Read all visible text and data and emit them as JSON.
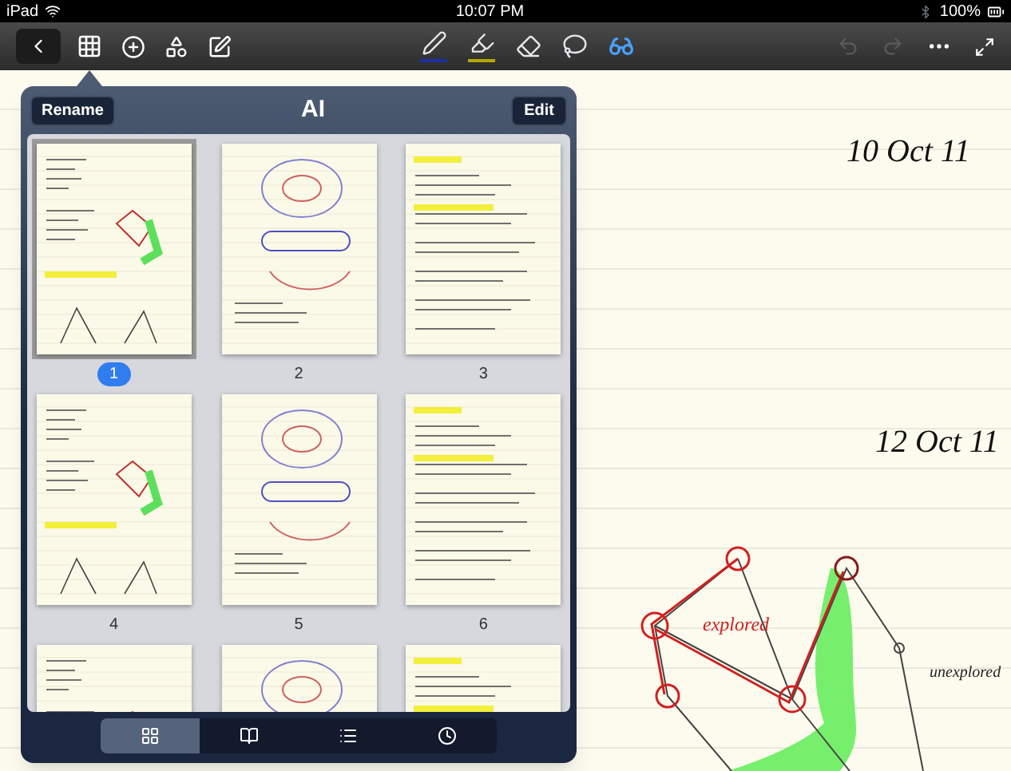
{
  "status_bar": {
    "device": "iPad",
    "time": "10:07 PM",
    "battery": "100%"
  },
  "toolbar": {
    "tools": [
      {
        "kind": "pen",
        "color": "#1f2fa8",
        "selected": false
      },
      {
        "kind": "highlighter",
        "color": "#b5a800",
        "selected": false
      },
      {
        "kind": "eraser",
        "selected": false
      },
      {
        "kind": "lasso",
        "selected": false
      },
      {
        "kind": "reader",
        "selected": true
      }
    ],
    "history": [
      {
        "kind": "undo",
        "disabled": true
      },
      {
        "kind": "redo",
        "disabled": true
      }
    ]
  },
  "popover": {
    "left_button": "Rename",
    "title": "AI",
    "right_button": "Edit",
    "pages": [
      {
        "number": "1",
        "selected": true
      },
      {
        "number": "2",
        "selected": false
      },
      {
        "number": "3",
        "selected": false
      },
      {
        "number": "4",
        "selected": false
      },
      {
        "number": "5",
        "selected": false
      },
      {
        "number": "6",
        "selected": false
      },
      {
        "selected": false
      },
      {
        "selected": false
      },
      {
        "selected": false
      }
    ],
    "tabs": [
      {
        "kind": "grid",
        "selected": true
      },
      {
        "kind": "book",
        "selected": false
      },
      {
        "kind": "list",
        "selected": false
      },
      {
        "kind": "clock",
        "selected": false
      }
    ]
  },
  "note": {
    "dates": [
      "10 Oct 11",
      "12 Oct 11"
    ],
    "labels": [
      "explored",
      "unexplored"
    ]
  }
}
